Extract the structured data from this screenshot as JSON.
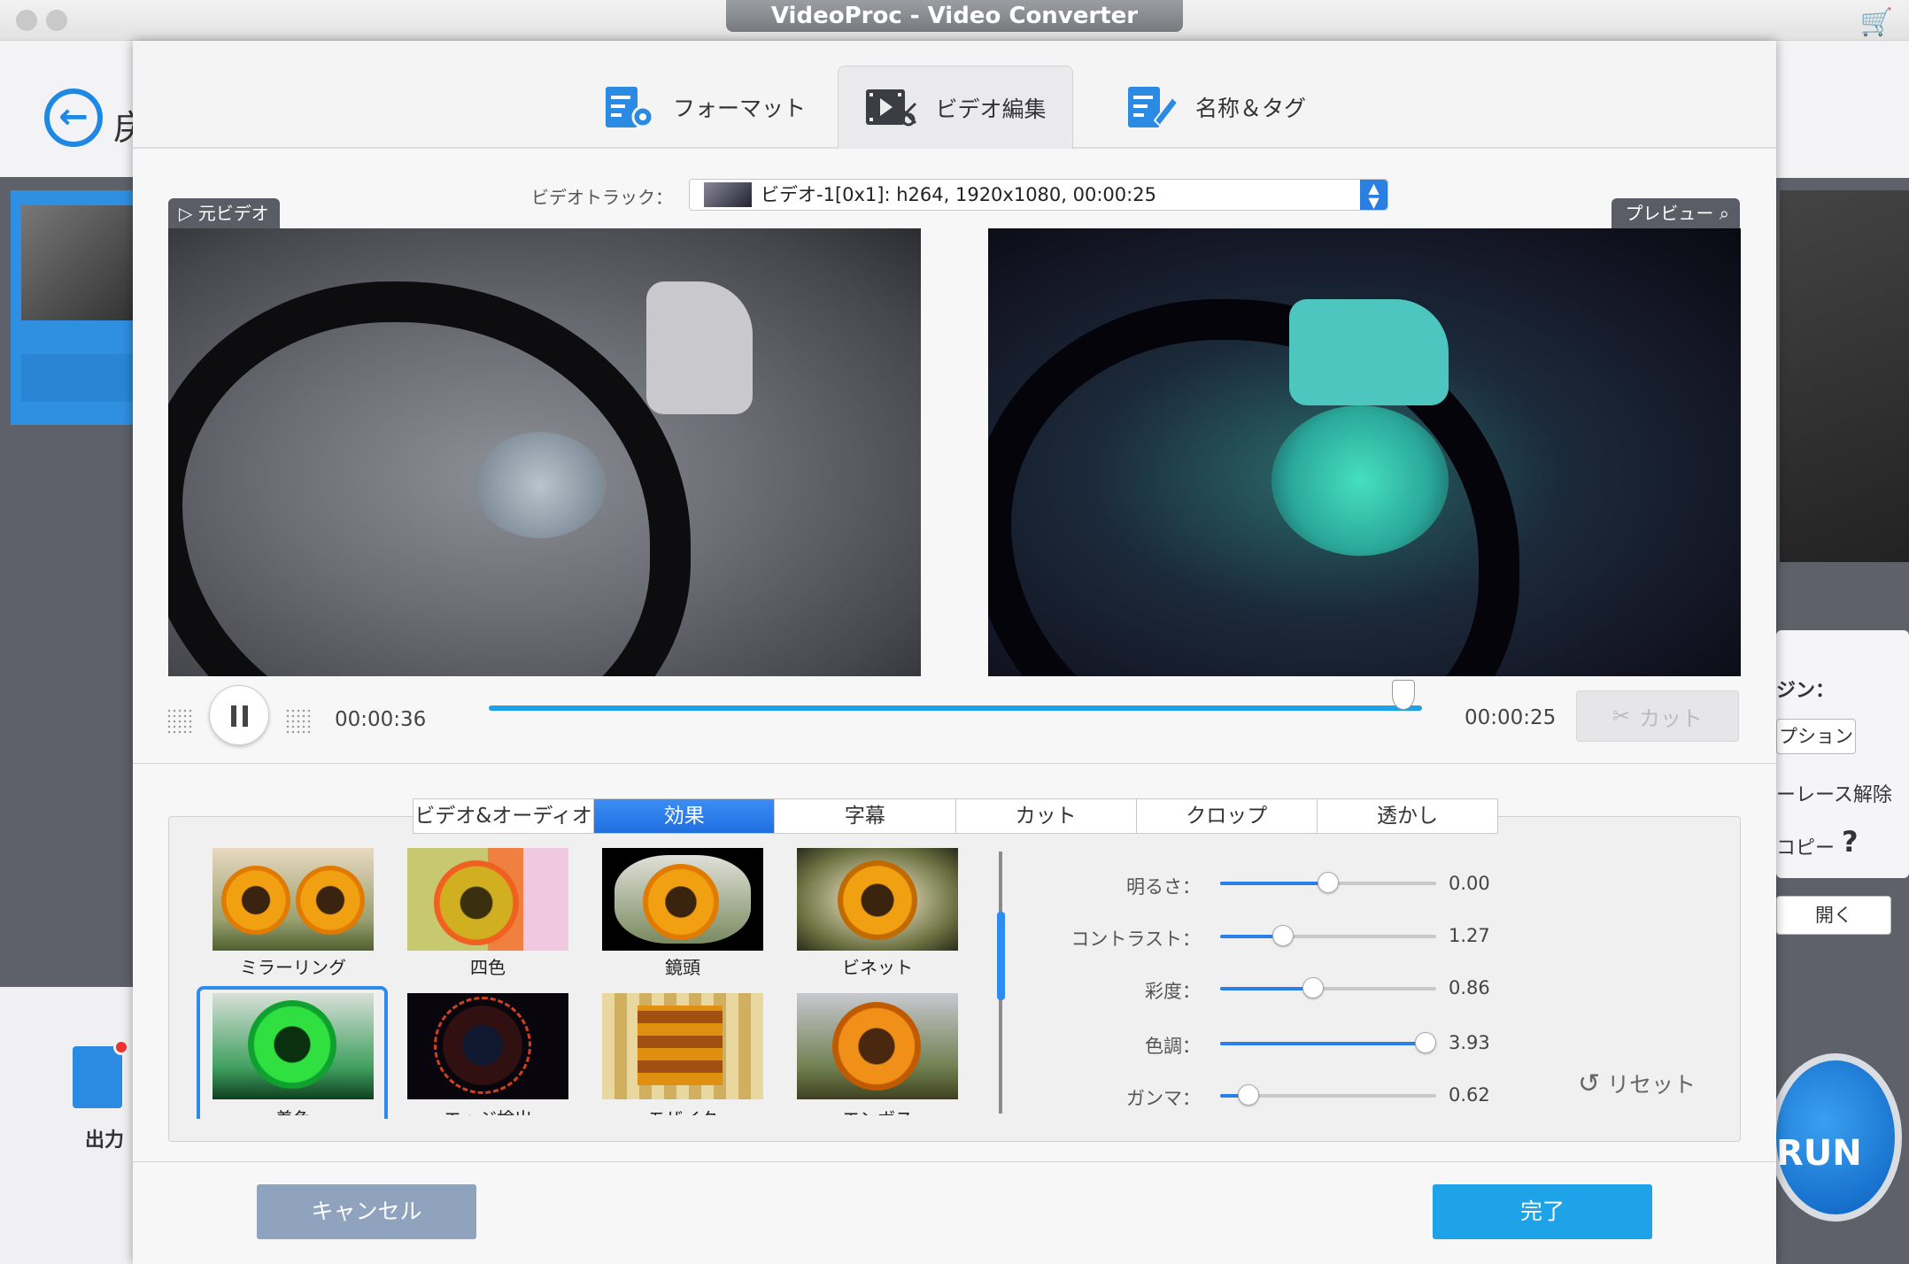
{
  "window": {
    "title": "VideoProc - Video Converter"
  },
  "background": {
    "back_label": "戻",
    "output_label": "出力",
    "right_panel": {
      "engine": "ジン：",
      "option": "プション",
      "deinterlace": "ーレース解除",
      "copy": "コピー",
      "help": "?",
      "open": "開く"
    },
    "run_label": "RUN"
  },
  "tabs": [
    {
      "label": "フォーマット",
      "icon": "format-icon"
    },
    {
      "label": "ビデオ編集",
      "icon": "video-edit-icon",
      "active": true
    },
    {
      "label": "名称＆タグ",
      "icon": "name-tag-icon"
    }
  ],
  "video_track": {
    "label": "ビデオトラック：",
    "value": "ビデオ-1[0x1]: h264, 1920x1080, 00:00:25"
  },
  "source_label": "元ビデオ",
  "preview_label": "プレビュー",
  "player": {
    "time_current": "00:00:36",
    "time_end": "00:00:25",
    "progress": 0.98,
    "cut_label": "カット"
  },
  "subtabs": [
    "ビデオ&オーディオ",
    "効果",
    "字幕",
    "カット",
    "クロップ",
    "透かし"
  ],
  "active_subtab": 1,
  "effects": [
    {
      "label": "ミラーリング"
    },
    {
      "label": "四色"
    },
    {
      "label": "鏡頭"
    },
    {
      "label": "ビネット"
    },
    {
      "label": "着色",
      "selected": true
    },
    {
      "label": "エッジ検出"
    },
    {
      "label": "モザイク"
    },
    {
      "label": "エンボス"
    }
  ],
  "sliders": [
    {
      "label": "明るさ：",
      "value": "0.00",
      "fraction": 0.5
    },
    {
      "label": "コントラスト：",
      "value": "1.27",
      "fraction": 0.29
    },
    {
      "label": "彩度：",
      "value": "0.86",
      "fraction": 0.43
    },
    {
      "label": "色調：",
      "value": "3.93",
      "fraction": 0.95
    },
    {
      "label": "ガンマ：",
      "value": "0.62",
      "fraction": 0.13
    }
  ],
  "reset_label": "リセット",
  "buttons": {
    "cancel": "キャンセル",
    "done": "完了"
  },
  "colors": {
    "accent": "#1ea2e8",
    "tab_active": "#2a80e8",
    "cart": "#e03c31"
  }
}
